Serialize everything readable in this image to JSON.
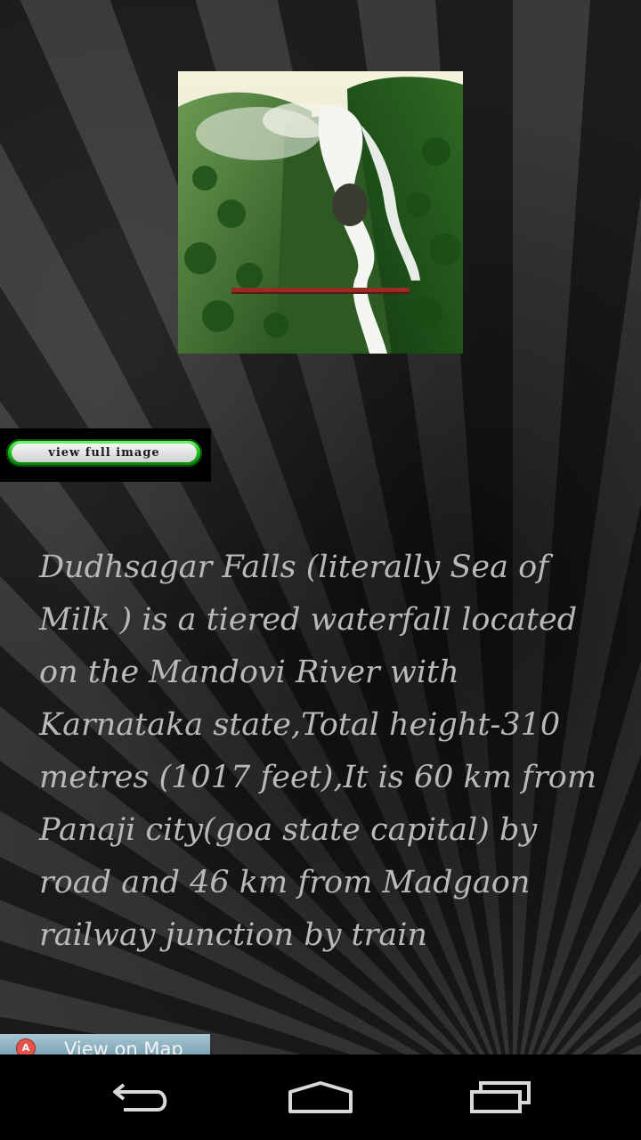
{
  "photo": {
    "subject": "waterfall-photo"
  },
  "buttons": {
    "view_full_image": "view full image",
    "view_on_map": "View on Map",
    "map_icon_letter": "A"
  },
  "description": "Dudhsagar Falls (literally Sea of Milk ) is a tiered waterfall located on the Mandovi River with Karnataka state,Total height-310 metres (1017 feet),It is 60 km from Panaji city(goa state capital) by road and 46 km from Madgaon railway junction by train",
  "navbar": {
    "icons": [
      "back-icon",
      "home-icon",
      "recent-apps-icon"
    ]
  },
  "colors": {
    "text": "#b9b9b9",
    "button_green": "#1fc21f",
    "navbar": "#000000"
  }
}
